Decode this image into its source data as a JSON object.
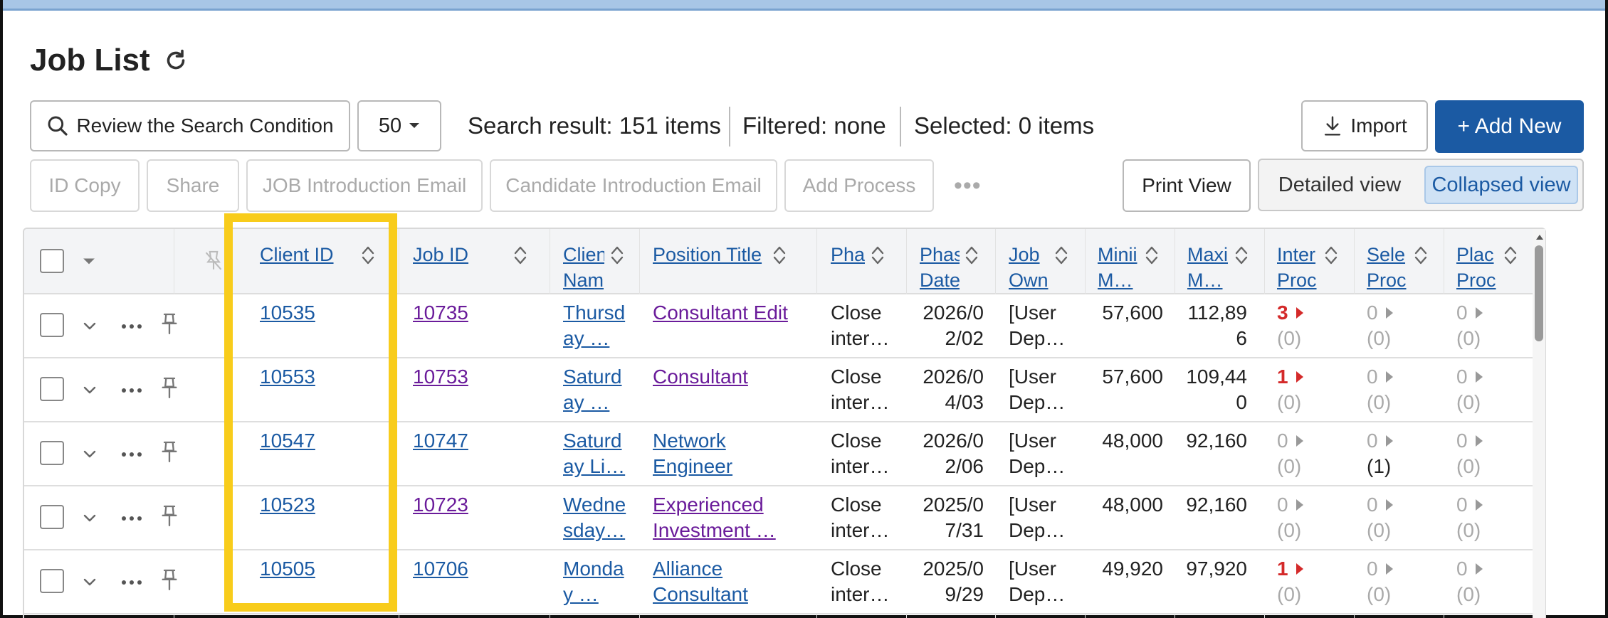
{
  "page": {
    "title": "Job List"
  },
  "toolbar": {
    "search_button": "Review the Search Condition",
    "page_size": "50",
    "search_result": "Search result: 151 items",
    "filtered": "Filtered: none",
    "selected": "Selected:  0 items",
    "import_button": "Import",
    "add_new_button": "+ Add New"
  },
  "actions": {
    "id_copy": "ID Copy",
    "share": "Share",
    "job_intro_email": "JOB Introduction Email",
    "candidate_intro_email": "Candidate Introduction Email",
    "add_process": "Add Process",
    "more": "•••",
    "print_view": "Print View",
    "detailed_view": "Detailed view",
    "collapsed_view": "Collapsed view"
  },
  "columns": {
    "client_id": "Client ID",
    "job_id": "Job ID",
    "client_name": [
      "Clien",
      "Nam"
    ],
    "position_title": "Position Title",
    "phase": "Pha",
    "phase_date": [
      "Phas",
      "Date"
    ],
    "job_owner": [
      "Job",
      "Own"
    ],
    "min": [
      "Minii",
      "M…"
    ],
    "max": [
      "Maxi",
      "M…"
    ],
    "interview": [
      "Inter",
      "Proc"
    ],
    "selection": [
      "Sele",
      "Proc"
    ],
    "placement": [
      "Plac",
      "Proc"
    ]
  },
  "rows": [
    {
      "client_id": "10535",
      "job_id": "10735",
      "job_visited": true,
      "client_name": [
        "Thursd",
        "ay …"
      ],
      "position": [
        "Consultant Edit",
        ""
      ],
      "pos_visited": true,
      "phase": [
        "Close",
        "inter…"
      ],
      "phase_date": [
        "2026/0",
        "2/02"
      ],
      "owner": [
        "[User",
        "Dep…"
      ],
      "min": "57,600",
      "max": [
        "112,89",
        "6"
      ],
      "inter": "3",
      "inter_red": true,
      "inter_sub": "(0)",
      "sel": "0",
      "sel_sub": "(0)",
      "plac": "0",
      "plac_sub": "(0)"
    },
    {
      "client_id": "10553",
      "job_id": "10753",
      "job_visited": true,
      "client_name": [
        "Saturd",
        "ay …"
      ],
      "position": [
        "Consultant",
        ""
      ],
      "pos_visited": true,
      "phase": [
        "Close",
        "inter…"
      ],
      "phase_date": [
        "2026/0",
        "4/03"
      ],
      "owner": [
        "[User",
        "Dep…"
      ],
      "min": "57,600",
      "max": [
        "109,44",
        "0"
      ],
      "inter": "1",
      "inter_red": true,
      "inter_sub": "(0)",
      "sel": "0",
      "sel_sub": "(0)",
      "plac": "0",
      "plac_sub": "(0)"
    },
    {
      "client_id": "10547",
      "job_id": "10747",
      "job_visited": false,
      "client_name": [
        "Saturd",
        "ay Li…"
      ],
      "position": [
        "Network ",
        "Engineer"
      ],
      "pos_visited": false,
      "phase": [
        "Close",
        "inter…"
      ],
      "phase_date": [
        "2026/0",
        "2/06"
      ],
      "owner": [
        "[User",
        "Dep…"
      ],
      "min": "48,000",
      "max": [
        "92,160",
        ""
      ],
      "inter": "0",
      "inter_red": false,
      "inter_sub": "(0)",
      "sel": "0",
      "sel_sub": "(1)",
      "plac": "0",
      "plac_sub": "(0)"
    },
    {
      "client_id": "10523",
      "job_id": "10723",
      "job_visited": true,
      "client_name": [
        "Wedne",
        "sday…"
      ],
      "position": [
        "Experienced ",
        "Investment …"
      ],
      "pos_visited": true,
      "phase": [
        "Close",
        "inter…"
      ],
      "phase_date": [
        "2025/0",
        "7/31"
      ],
      "owner": [
        "[User",
        "Dep…"
      ],
      "min": "48,000",
      "max": [
        "92,160",
        ""
      ],
      "inter": "0",
      "inter_red": false,
      "inter_sub": "(0)",
      "sel": "0",
      "sel_sub": "(0)",
      "plac": "0",
      "plac_sub": "(0)"
    },
    {
      "client_id": "10505",
      "job_id": "10706",
      "job_visited": false,
      "client_name": [
        "Monda",
        "y …"
      ],
      "position": [
        "Alliance ",
        "Consultant"
      ],
      "pos_visited": false,
      "phase": [
        "Close",
        "inter…"
      ],
      "phase_date": [
        "2025/0",
        "9/29"
      ],
      "owner": [
        "[User",
        "Dep…"
      ],
      "min": "49,920",
      "max": [
        "97,920",
        ""
      ],
      "inter": "1",
      "inter_red": true,
      "inter_sub": "(0)",
      "sel": "0",
      "sel_sub": "(0)",
      "plac": "0",
      "plac_sub": "(0)"
    }
  ],
  "colors": {
    "link": "#1b5aa3",
    "visited": "#6a1b9a",
    "primary": "#1b5aa3",
    "highlight": "#f8cc1b",
    "count_red": "#d42a2a"
  }
}
